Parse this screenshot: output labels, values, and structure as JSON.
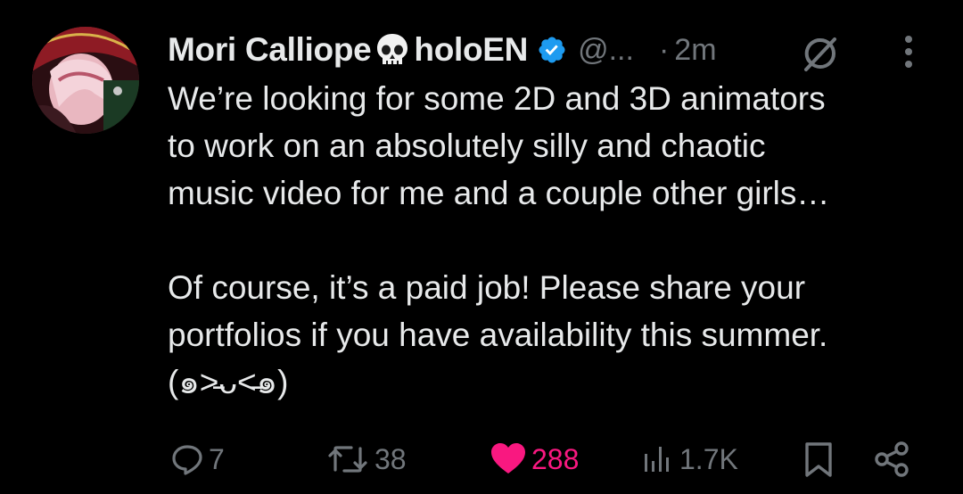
{
  "tweet": {
    "author_name": "Mori Calliope",
    "author_suffix": "holoEN",
    "handle": "@...",
    "separator": "·",
    "time": "2m",
    "text": "We’re looking for some 2D and 3D animators\nto work on an absolutely silly and chaotic\nmusic video for me and a couple other girls…\n\nOf course, it’s a paid job! Please share your\nportfolios if you have availability this summer.\n(๑˃̵ᴗ˂̵๑)",
    "text_line_1": "We’re looking for some 2D and 3D animators",
    "text_line_2": "to work on an absolutely silly and chaotic",
    "text_line_3": "music video for me and a couple other girls…",
    "text_line_4": "Of course, it’s a paid job! Please share your",
    "text_line_5": "portfolios if you have availability this summer.",
    "text_line_6": "(๑˃̵ᴗ˂̵๑)"
  },
  "actions": {
    "replies": "7",
    "reposts": "38",
    "likes": "288",
    "views": "1.7K"
  },
  "icons": {
    "verified": "verified-badge-icon",
    "grok": "grok-icon",
    "more": "more-options-icon",
    "reply": "reply-icon",
    "repost": "repost-icon",
    "like": "heart-icon",
    "views": "views-icon",
    "bookmark": "bookmark-icon",
    "share": "share-icon"
  },
  "colors": {
    "background": "#000000",
    "text": "#e7e9ea",
    "muted": "#71767b",
    "verified": "#1d9bf0",
    "like": "#f91880"
  }
}
